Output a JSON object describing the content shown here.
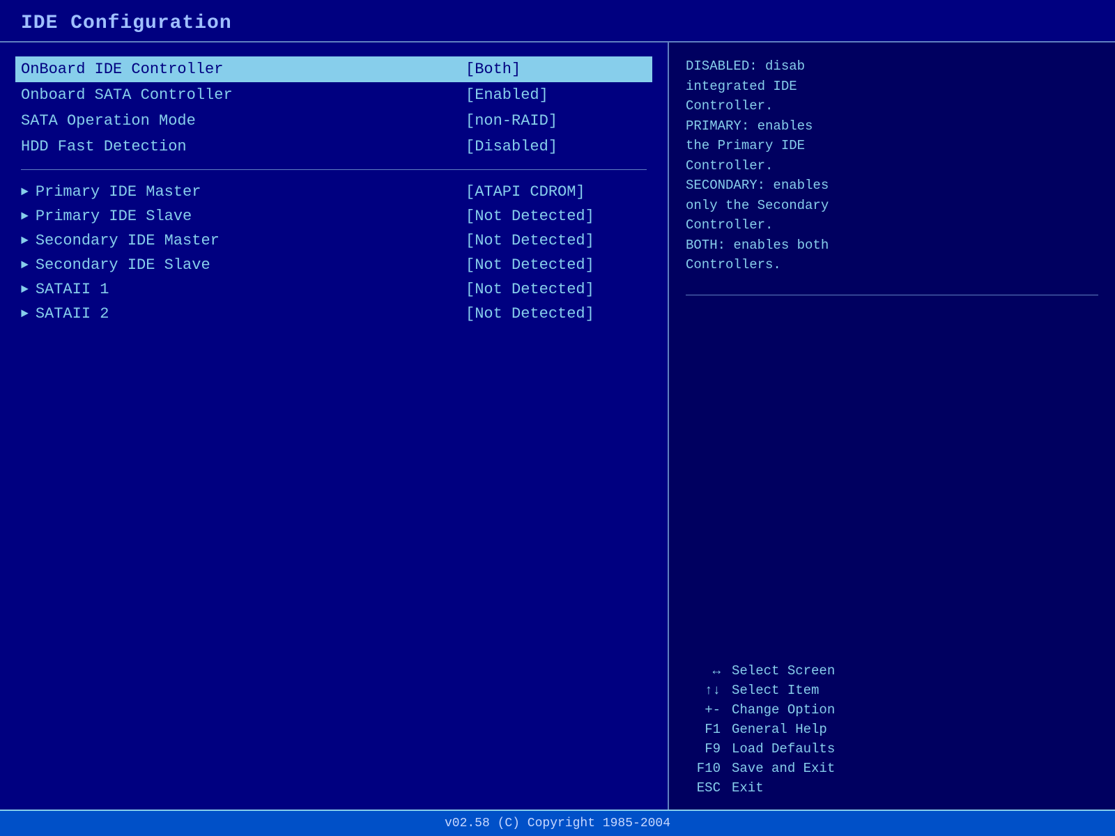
{
  "title": "IDE Configuration",
  "settings": [
    {
      "label": "OnBoard IDE Controller",
      "value": "[Both]",
      "highlighted": true
    },
    {
      "label": "Onboard SATA Controller",
      "value": "[Enabled]",
      "highlighted": false
    },
    {
      "label": "  SATA Operation Mode",
      "value": "[non-RAID]",
      "highlighted": false
    },
    {
      "label": "HDD Fast Detection",
      "value": "[Disabled]",
      "highlighted": false
    }
  ],
  "drives": [
    {
      "label": "Primary IDE Master",
      "value": "[ATAPI CDROM]"
    },
    {
      "label": "Primary IDE Slave",
      "value": "[Not Detected]"
    },
    {
      "label": "Secondary IDE Master",
      "value": "[Not Detected]"
    },
    {
      "label": "Secondary IDE Slave",
      "value": "[Not Detected]"
    },
    {
      "label": "SATAII 1",
      "value": "[Not Detected]"
    },
    {
      "label": "SATAII 2",
      "value": "[Not Detected]"
    }
  ],
  "help": {
    "lines": [
      "DISABLED: disab",
      "integrated IDE",
      "Controller.",
      "PRIMARY: enables",
      "the Primary IDE",
      "Controller.",
      "SECONDARY: enables",
      "only the Secondary",
      "Controller.",
      "BOTH: enables both",
      "Controllers."
    ]
  },
  "keys": [
    {
      "symbol": "↔",
      "desc": "Select Screen"
    },
    {
      "symbol": "↑↓",
      "desc": "Select Item"
    },
    {
      "symbol": "+-",
      "desc": "Change Option"
    },
    {
      "symbol": "F1",
      "desc": "General Help"
    },
    {
      "symbol": "F9",
      "desc": "Load Defaults"
    },
    {
      "symbol": "F10",
      "desc": "Save and Exit"
    },
    {
      "symbol": "ESC",
      "desc": "Exit"
    }
  ],
  "footer": "v02.58  (C) Copyright 1985-2004"
}
